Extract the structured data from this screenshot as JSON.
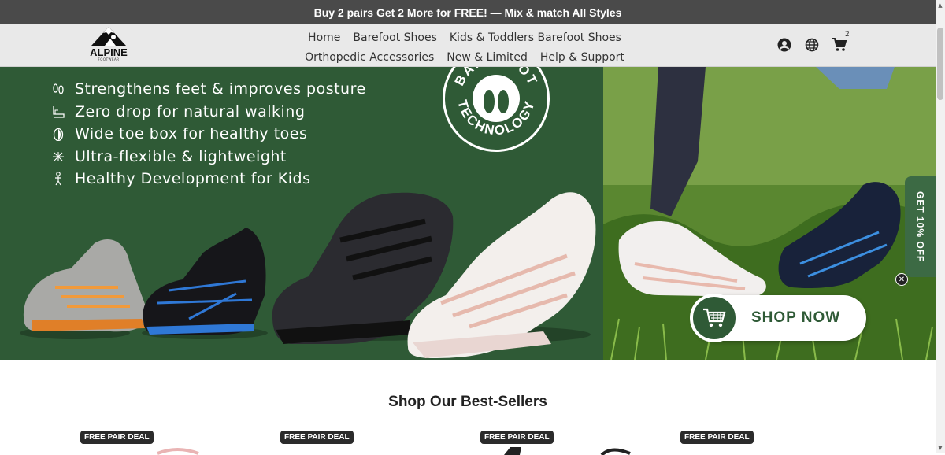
{
  "announcement": {
    "text": "Buy 2 pairs Get 2 More for FREE! — Mix & match All Styles"
  },
  "logo": {
    "word": "ALPINE",
    "sub": "FOOTWEAR"
  },
  "nav": {
    "row1": [
      "Home",
      "Barefoot Shoes",
      "Kids & Toddlers Barefoot Shoes"
    ],
    "row2": [
      "Orthopedic Accessories",
      "New & Limited",
      "Help & Support"
    ]
  },
  "header_icons": {
    "account": "account-icon",
    "language": "globe-icon",
    "cart": "cart-icon",
    "cart_count": "2"
  },
  "hero": {
    "features": [
      {
        "icon": "footprints-icon",
        "text": "Strengthens feet & improves posture"
      },
      {
        "icon": "zero-drop-icon",
        "text": "Zero drop for natural walking"
      },
      {
        "icon": "toe-box-icon",
        "text": "Wide toe box for healthy toes"
      },
      {
        "icon": "flexible-icon",
        "text": "Ultra-flexible & lightweight"
      },
      {
        "icon": "kid-icon",
        "text": "Healthy Development for Kids"
      }
    ],
    "badge_text_top": "BAREFOOT",
    "badge_text_bottom": "TECHNOLOGY",
    "shop_now": "SHOP NOW",
    "colors": {
      "green": "#2f5a36"
    }
  },
  "side_tab": {
    "label": "GET 10% OFF"
  },
  "bestsellers": {
    "title": "Shop Our Best-Sellers",
    "badges": [
      "FREE PAIR DEAL",
      "FREE PAIR DEAL",
      "FREE PAIR DEAL",
      "FREE PAIR DEAL"
    ]
  }
}
